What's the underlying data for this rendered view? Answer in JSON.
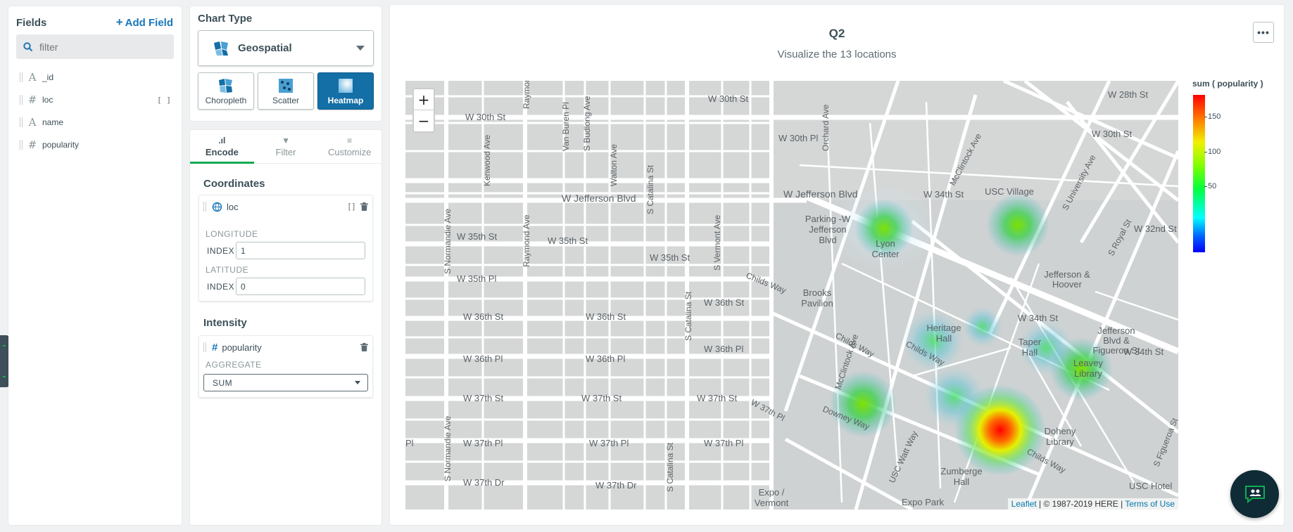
{
  "fields_panel": {
    "title": "Fields",
    "add_field_label": "Add Field",
    "filter_placeholder": "filter",
    "fields": [
      {
        "name": "_id",
        "type_icon": "string-icon",
        "glyph": "A"
      },
      {
        "name": "loc",
        "type_icon": "number-icon",
        "glyph": "#",
        "is_array": true
      },
      {
        "name": "name",
        "type_icon": "string-icon",
        "glyph": "A"
      },
      {
        "name": "popularity",
        "type_icon": "number-icon",
        "glyph": "#"
      }
    ]
  },
  "chart_type": {
    "title": "Chart Type",
    "selected": "Geospatial",
    "subtypes": [
      {
        "label": "Choropleth",
        "active": false
      },
      {
        "label": "Scatter",
        "active": false
      },
      {
        "label": "Heatmap",
        "active": true
      }
    ]
  },
  "encode": {
    "tabs": [
      {
        "label": "Encode",
        "active": true
      },
      {
        "label": "Filter",
        "active": false
      },
      {
        "label": "Customize",
        "active": false
      }
    ],
    "coordinates_title": "Coordinates",
    "coordinates_field": "loc",
    "longitude_label": "LONGITUDE",
    "latitude_label": "LATITUDE",
    "index_label": "INDEX",
    "longitude_index": "1",
    "latitude_index": "0",
    "intensity_title": "Intensity",
    "intensity_field": "popularity",
    "aggregate_label": "AGGREGATE",
    "aggregate_value": "SUM"
  },
  "chart": {
    "title": "Q2",
    "subtitle": "Visualize the 13 locations",
    "more_label": "•••",
    "zoom_in": "+",
    "zoom_out": "−",
    "attribution": {
      "leaflet": "Leaflet",
      "text": "| © 1987-2019 HERE |",
      "terms": "Terms of Use"
    },
    "legend": {
      "title": "sum ( popularity )",
      "ticks": [
        "150",
        "100",
        "50"
      ]
    },
    "map_labels": [
      "W 30th St",
      "W 30th St",
      "W 30th Pl",
      "W Jefferson Blvd",
      "W Jefferson Blvd",
      "W 35th St",
      "W 35th St",
      "W 35th St",
      "W 35th Pl",
      "W 36th St",
      "W 36th St",
      "W 36th St",
      "W 36th Pl",
      "W 36th Pl",
      "W 36th Pl",
      "W 37th St",
      "W 37th St",
      "W 37th St",
      "W 37th Pl",
      "W 37th Pl",
      "W 37th Pl",
      "W 37th Dr",
      "W 37th Dr",
      "Parking -W Jefferson Blvd",
      "Lyon Center",
      "USC Village",
      "Jefferson & Hoover",
      "Brooks Pavilion",
      "Heritage Hall",
      "Taper Hall",
      "Jefferson Blvd & Figueroa St",
      "Leavey Library",
      "Doheny Library",
      "Zumberge Hall",
      "Downey Way",
      "Childs Way",
      "Expo / Vermont",
      "Expo Park",
      "USC Hotel",
      "W 28th St",
      "W 30th St",
      "W 32nd St",
      "W 34th St",
      "W 34th St",
      "S Normandie Ave",
      "Raymond Ave",
      "S Catalina St",
      "S Vermont Ave",
      "McClintock Ave",
      "USC Watt Way",
      "Kenwood Ave",
      "Van Buren Pl",
      "S Budlong Ave",
      "Walton Ave",
      "Orchard Ave",
      "S University Ave",
      "S Royal St",
      "S Figueroa St",
      "W 37th Pl",
      "W 34th St",
      "McClintock Ave",
      "Childs Way"
    ]
  },
  "colors": {
    "accent": "#136fa6",
    "active_tab": "#13aa52",
    "link": "#1a77ba"
  }
}
